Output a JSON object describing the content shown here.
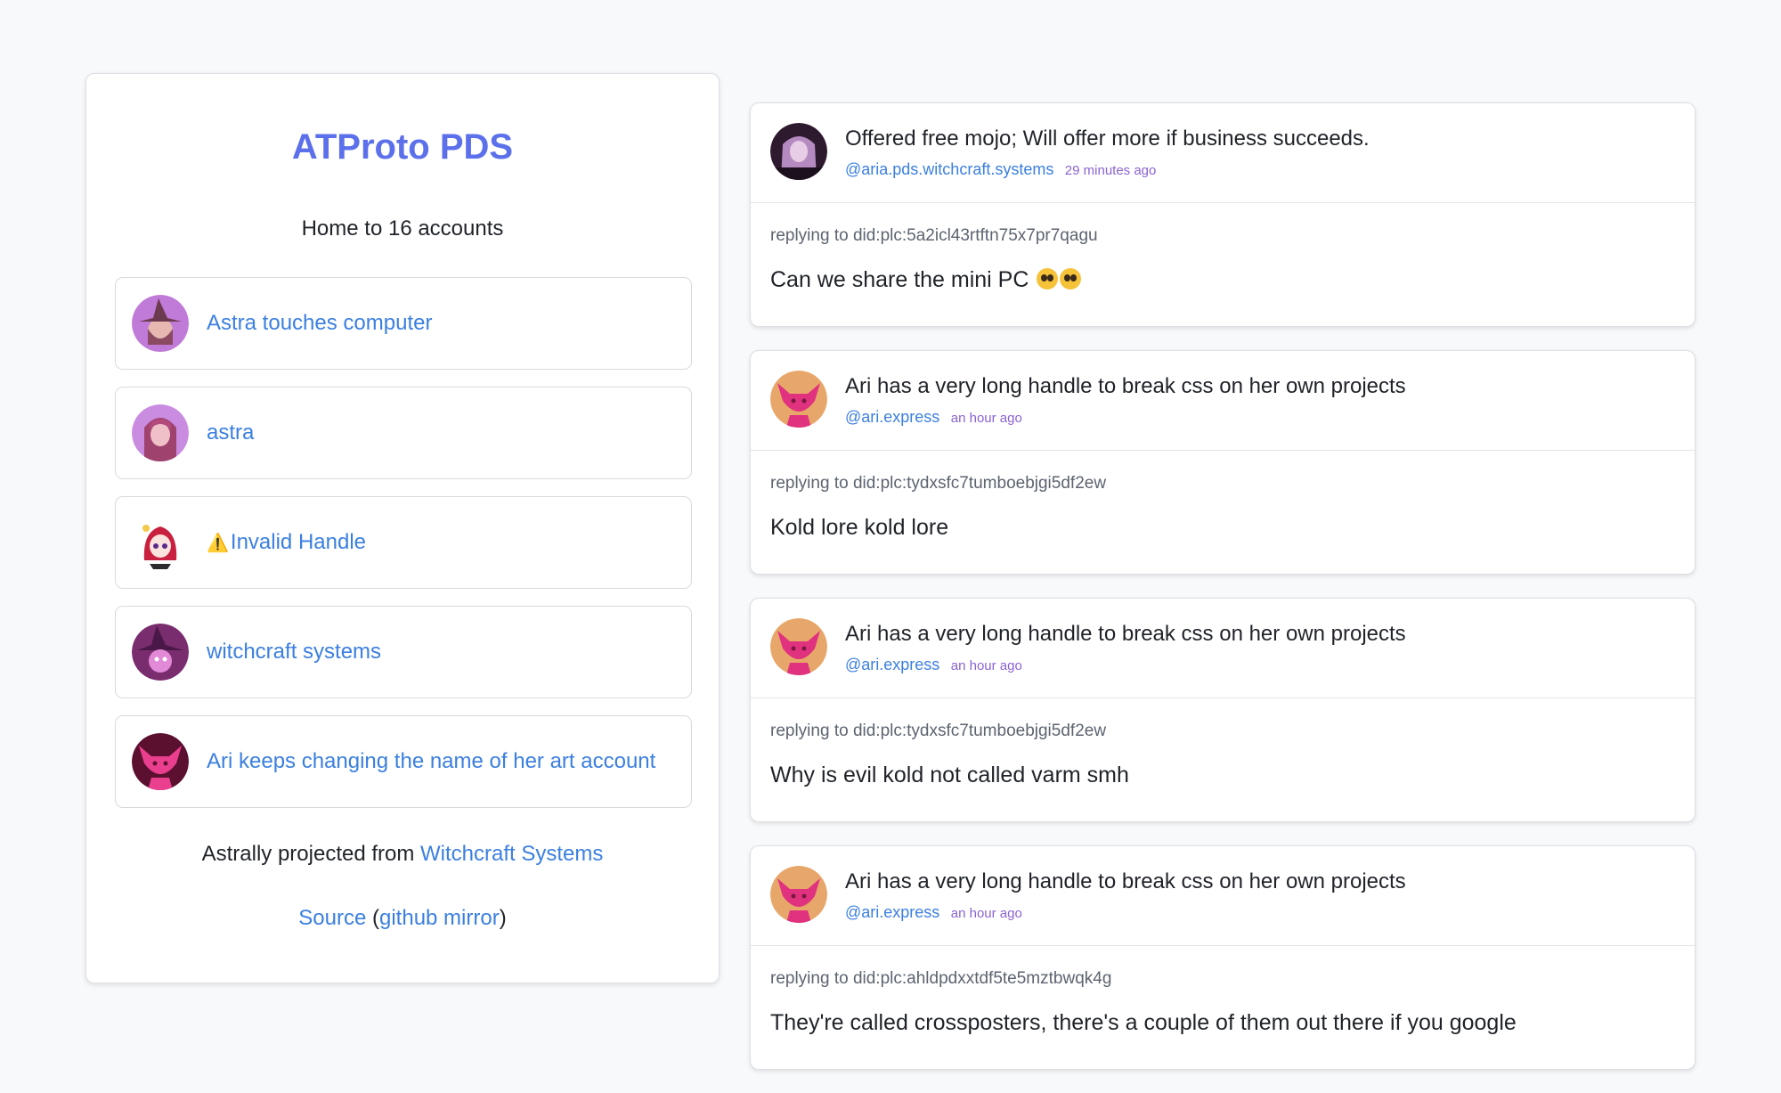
{
  "site": {
    "title": "ATProto PDS",
    "subtitle": "Home to 16 accounts"
  },
  "accounts": [
    {
      "name": "Astra touches computer",
      "avatar": "witch-hat-avatar",
      "colors": {
        "bg": "#c07ad8",
        "fg": "#6b3a4e"
      }
    },
    {
      "name": "astra",
      "avatar": "pink-hair-avatar",
      "colors": {
        "bg": "#c98ce0",
        "fg": "#a0426e"
      }
    },
    {
      "name": "Invalid Handle",
      "warning": "⚠️",
      "avatar": "anime-girl-avatar",
      "colors": {
        "bg": "#ffffff",
        "fg": "#c8203e"
      }
    },
    {
      "name": "witchcraft systems",
      "avatar": "purple-witch-avatar",
      "colors": {
        "bg": "#7a2d6e",
        "fg": "#e28ad8"
      }
    },
    {
      "name": "Ari keeps changing the name of her art account",
      "avatar": "pink-creature-avatar",
      "colors": {
        "bg": "#5c1030",
        "fg": "#ea3f8e"
      }
    }
  ],
  "footer": {
    "projected_prefix": "Astrally projected from",
    "projected_link": "Witchcraft Systems",
    "source_link": "Source",
    "mirror_open": "(",
    "mirror_link": "github mirror",
    "mirror_close": ")"
  },
  "posts": [
    {
      "author": "Offered free mojo; Will offer more if business succeeds.",
      "handle": "@aria.pds.witchcraft.systems",
      "time": "29 minutes ago",
      "reply_to": "replying to did:plc:5a2icl43rtftn75x7pr7qagu",
      "text": "Can we share the mini PC",
      "emoji": [
        "pleading-face",
        "pleading-face"
      ],
      "avatar": "dark-purple-avatar",
      "colors": {
        "bg": "#2e1a2e",
        "fg": "#b58ac0"
      }
    },
    {
      "author": "Ari has a very long handle to break css on her own projects",
      "handle": "@ari.express",
      "time": "an hour ago",
      "reply_to": "replying to did:plc:tydxsfc7tumboebjgi5df2ew",
      "text": "Kold lore kold lore",
      "avatar": "pink-creature-avatar",
      "colors": {
        "bg": "#e8a76a",
        "fg": "#e0327e"
      }
    },
    {
      "author": "Ari has a very long handle to break css on her own projects",
      "handle": "@ari.express",
      "time": "an hour ago",
      "reply_to": "replying to did:plc:tydxsfc7tumboebjgi5df2ew",
      "text": "Why is evil kold not called varm smh",
      "avatar": "pink-creature-avatar",
      "colors": {
        "bg": "#e8a76a",
        "fg": "#e0327e"
      }
    },
    {
      "author": "Ari has a very long handle to break css on her own projects",
      "handle": "@ari.express",
      "time": "an hour ago",
      "reply_to": "replying to did:plc:ahldpdxxtdf5te5mztbwqk4g",
      "text": "They're called crossposters, there's a couple of them out there if you google",
      "avatar": "pink-creature-avatar",
      "colors": {
        "bg": "#e8a76a",
        "fg": "#e0327e"
      }
    }
  ],
  "theme": {
    "accent": "#5b70ea",
    "link": "#3b7fe0",
    "time": "#8a63d2"
  }
}
